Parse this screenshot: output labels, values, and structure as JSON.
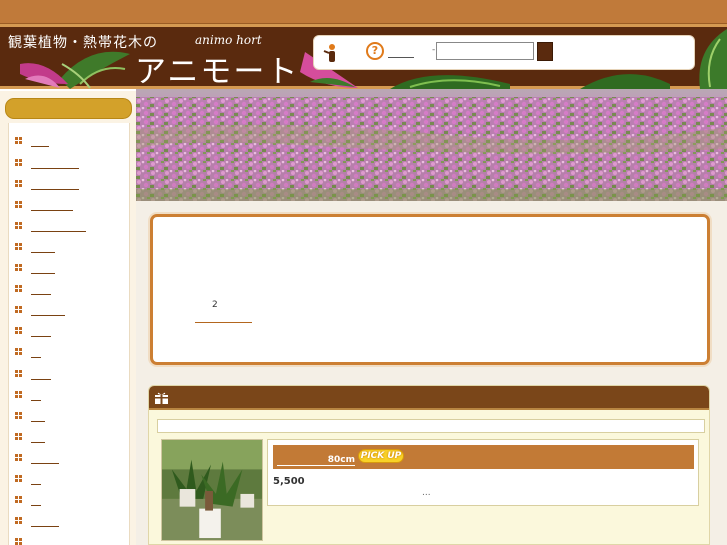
{
  "header": {
    "subtitle": "観葉植物・熱帯花木の",
    "subtitle_en": "animo hort",
    "brand": "アニモート",
    "search": {
      "value": "",
      "placeholder": ""
    },
    "dash": "-"
  },
  "sidebar": {
    "items": [
      "",
      "",
      "",
      "",
      "",
      "",
      "",
      "",
      "",
      "",
      "",
      "",
      "",
      "",
      "",
      "",
      "",
      "",
      "",
      ""
    ]
  },
  "notice": {
    "number": "2"
  },
  "products": [
    {
      "title": "80cm",
      "badge": "PICK UP",
      "price": "5,500",
      "more": "..."
    }
  ],
  "colors": {
    "topbar": "#c07a3a",
    "header": "#5a2a0e",
    "sidebar_head": "#d3a12a",
    "accent_orange": "#cc7f33",
    "section_head": "#7a4619",
    "product_title_bar": "#c27a36",
    "pickup_badge": "#f8d227"
  },
  "icons": [
    "person-icon",
    "help-icon",
    "search-button",
    "list-bullet-icon",
    "gift-icon"
  ]
}
